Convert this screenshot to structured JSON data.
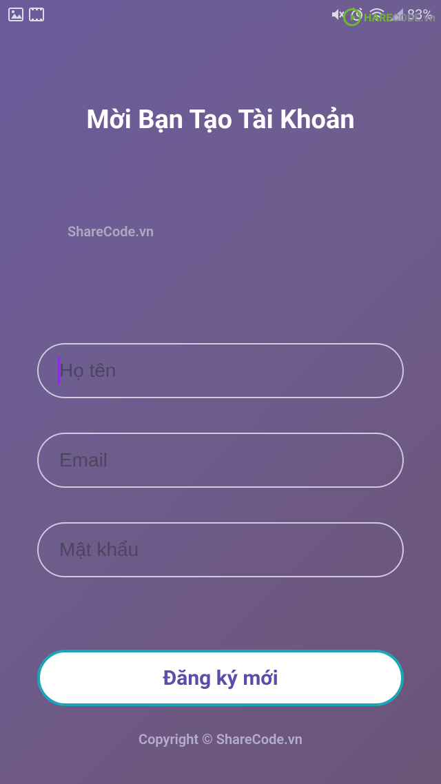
{
  "statusbar": {
    "battery": "83%"
  },
  "watermark": {
    "logo_share": "HARE",
    "logo_code": "CODE",
    "logo_vn": ".vn",
    "mid": "ShareCode.vn"
  },
  "page": {
    "title": "Mời Bạn Tạo Tài Khoản"
  },
  "form": {
    "name_placeholder": "Họ tên",
    "email_placeholder": "Email",
    "password_placeholder": "Mật khẩu",
    "name_value": "",
    "email_value": "",
    "password_value": ""
  },
  "button": {
    "submit_label": "Đăng ký mới"
  },
  "footer": {
    "copyright": "Copyright © ShareCode.vn"
  }
}
